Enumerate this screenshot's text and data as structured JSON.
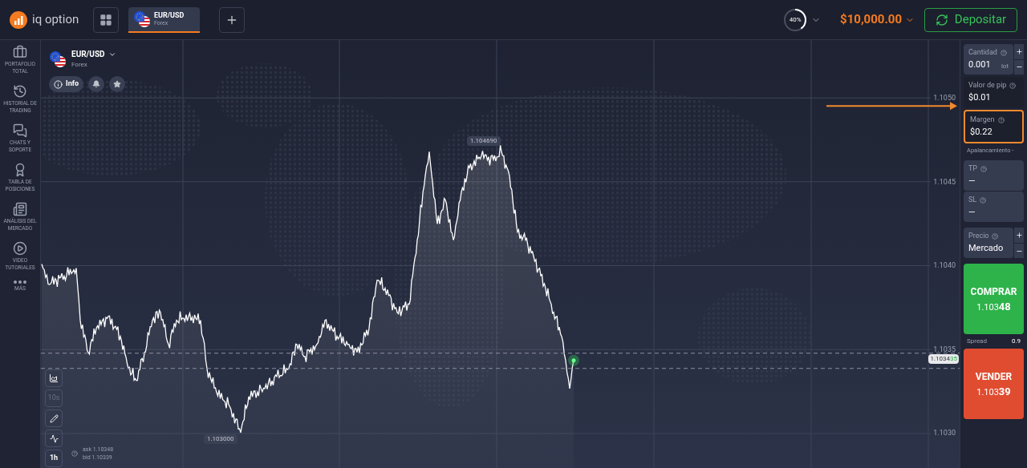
{
  "header": {
    "logo_text": "iq option",
    "asset_tab": {
      "symbol": "EUR/USD",
      "market": "Forex",
      "selected": true
    },
    "progress": {
      "label": "40%"
    },
    "balance": "$10,000.00",
    "deposit_button": "Depositar"
  },
  "sidebar": {
    "items": [
      {
        "kind": "portfolio",
        "label": "PORTAFOLIO TOTAL"
      },
      {
        "kind": "history",
        "label": "HISTORIAL DE TRADING"
      },
      {
        "kind": "chat",
        "label": "CHATS Y SOPORTE"
      },
      {
        "kind": "leaderboard",
        "label": "TABLA DE POSICIONES"
      },
      {
        "kind": "news",
        "label": "ANÁLISIS DEL MERCADO"
      },
      {
        "kind": "video",
        "label": "VIDEO TUTORIALES"
      },
      {
        "kind": "more",
        "label": "MÁS"
      }
    ]
  },
  "asset": {
    "symbol": "EUR/USD",
    "market": "Forex",
    "info_button": "Info"
  },
  "chart": {
    "price_labels": [
      "1.1050",
      "1.1045",
      "1.1040",
      "1.1035",
      "1.1030"
    ],
    "high_label": "1.104690",
    "low_label": "1.103000",
    "current_price": {
      "base": "1.1034",
      "pips": "35"
    }
  },
  "chart_tools": [
    {
      "kind": "chart-type"
    },
    {
      "kind": "text",
      "label": "10s",
      "disabled": true
    },
    {
      "kind": "draw"
    },
    {
      "kind": "indicator"
    },
    {
      "kind": "text",
      "label": "1h",
      "disabled": false
    }
  ],
  "quote": {
    "ask": "ask 1.10348",
    "bid": "bid 1.10339"
  },
  "order": {
    "amount": {
      "label": "Cantidad",
      "value": "0.001",
      "unit": "lot"
    },
    "pip_value": {
      "label": "Valor de pip",
      "value": "$0.01"
    },
    "margin": {
      "label": "Margen",
      "value": "$0.22",
      "highlighted": true
    },
    "leverage": "Apalancamiento -",
    "tp": {
      "label": "TP",
      "value": "—"
    },
    "sl": {
      "label": "SL",
      "value": "—"
    },
    "price": {
      "label": "Precio",
      "value": "Mercado"
    },
    "buy": {
      "label": "COMPRAR",
      "base": "1.103",
      "pips": "48"
    },
    "spread": {
      "label": "Spread",
      "value": "0.9"
    },
    "sell": {
      "label": "VENDER",
      "base": "1.103",
      "pips": "39"
    }
  }
}
